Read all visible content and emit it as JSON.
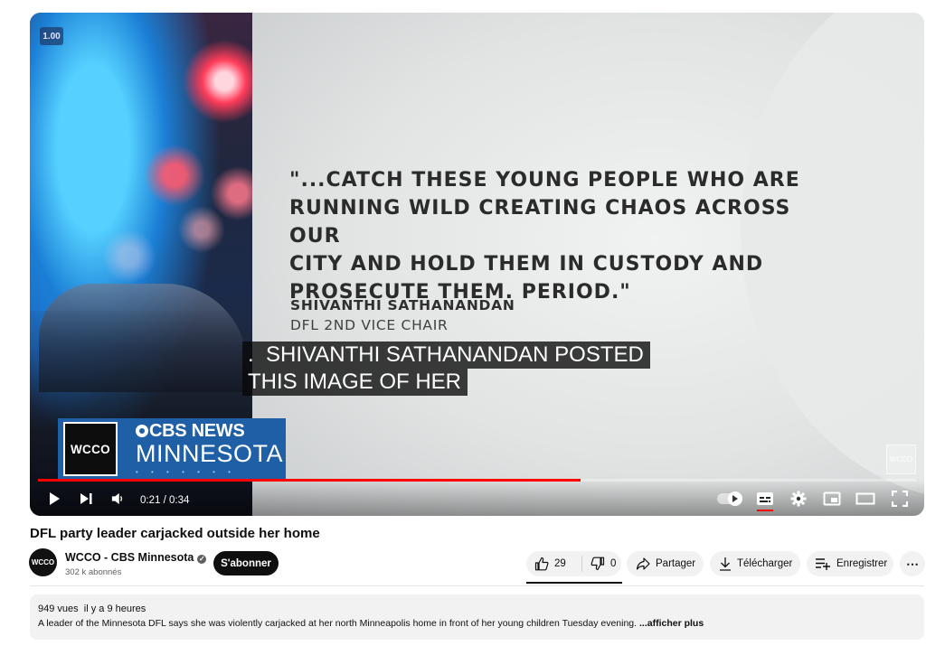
{
  "player": {
    "speed_badge": "1.00",
    "quote": "\"...CATCH THESE YOUNG PEOPLE WHO ARE\nRUNNING WILD CREATING CHAOS ACROSS OUR\nCITY AND HOLD THEM IN CUSTODY AND\nPROSECUTE THEM. PERIOD.\"",
    "speaker_name": "SHIVANTHI SATHANANDAN",
    "speaker_title": "DFL 2ND VICE CHAIR",
    "captions": [
      ".  SHIVANTHI SATHANANDAN POSTED",
      "THIS IMAGE OF HER"
    ],
    "logo": {
      "wcco": "WCCO",
      "cbs_news": "CBS NEWS",
      "minnesota": "MINNESOTA"
    },
    "watermark": "WCCO",
    "time_current": "0:21",
    "time_total": "0:34",
    "progress_fraction": 0.6176,
    "icons": [
      "play-icon",
      "next-icon",
      "volume-icon",
      "autoplay-toggle",
      "subtitles-icon",
      "settings-icon",
      "miniplayer-icon",
      "theater-icon",
      "fullscreen-icon"
    ]
  },
  "video": {
    "title": "DFL party leader carjacked outside her home"
  },
  "channel": {
    "avatar_text": "WCCO",
    "name": "WCCO - CBS Minnesota",
    "subscribers": "302 k abonnés",
    "subscribe_label": "S'abonner"
  },
  "actions": {
    "likes": "29",
    "dislikes": "0",
    "share": "Partager",
    "download": "Télécharger",
    "save": "Enregistrer",
    "more": "⋯"
  },
  "description": {
    "views": "949 vues",
    "date": "il y a 9 heures",
    "text": "A leader of the Minnesota DFL says she was violently carjacked at her north Minneapolis home in front of her young children Tuesday evening. ",
    "show_more": "...afficher plus"
  },
  "colors": {
    "accent_red": "#ff0000",
    "cbs_blue": "#1f5fa6",
    "pill_bg": "#f2f2f2"
  }
}
